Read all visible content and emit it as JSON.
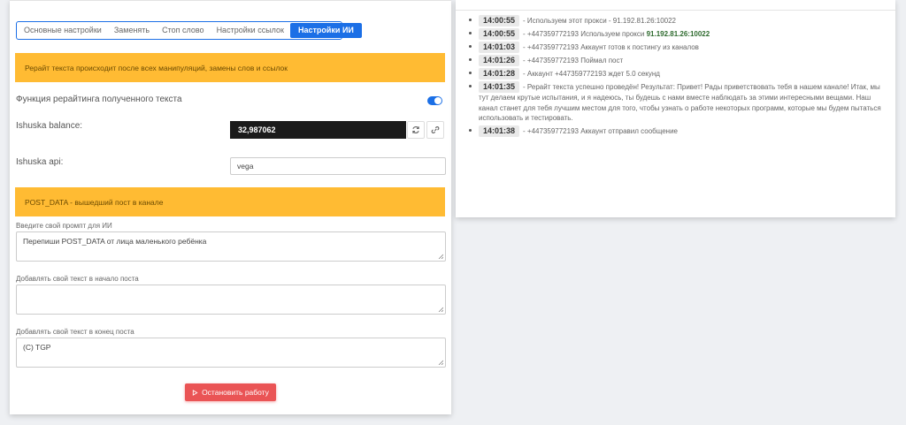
{
  "tabs": [
    {
      "label": "Основные настройки"
    },
    {
      "label": "Заменять"
    },
    {
      "label": "Стоп слово"
    },
    {
      "label": "Настройки ссылок"
    },
    {
      "label": "Настройки ИИ",
      "active": true
    }
  ],
  "alert_rewrite": "Рерайт текста происходит после всех манипуляций, замены слов и ссылок",
  "rewrite_function_label": "Функция рерайтинга полученного текста",
  "rewrite_enabled": true,
  "balance_label": "Ishuska balance:",
  "balance_value": "32,987062",
  "api_label": "Ishuska api:",
  "api_value": "vega",
  "alert_post_data": "POST_DATA - вышедший пост в канале",
  "prompt_label": "Введите свой промпт для ИИ",
  "prompt_value": "Перепиши POST_DATA от лица маленького ребёнка",
  "prefix_label": "Добавлять свой текст в начало поста",
  "prefix_value": "",
  "suffix_label": "Добавлять свой текст в конец поста",
  "suffix_value": "(C) TGP",
  "stop_button": "Остановить работу",
  "colors": {
    "accent": "#1b6fe6",
    "alert": "#ffbb33",
    "danger": "#ea5455",
    "success": "#28c76f"
  },
  "log": [
    {
      "time": "14:00:55",
      "text": "- Используем этот прокси - 91.192.81.26:10022"
    },
    {
      "time": "14:00:55",
      "text": "- +447359772193 Используем прокси ",
      "highlight": "91.192.81.26:10022"
    },
    {
      "time": "14:01:03",
      "text": "- +447359772193 Аккаунт готов к постингу из каналов"
    },
    {
      "time": "14:01:26",
      "text": "- +447359772193 Поймал пост"
    },
    {
      "time": "14:01:28",
      "text": "- Аккаунт +447359772193 ждет 5.0 секунд"
    },
    {
      "time": "14:01:35",
      "text": "- Рерайт текста успешно проведён! Результат: Привет! Рады приветствовать тебя в нашем канале! Итак, мы тут делаем крутые испытания, и я надеюсь, ты будешь с нами вместе наблюдать за этими интересными вещами. Наш канал станет для тебя лучшим местом для того, чтобы узнать о работе некоторых программ, которые мы будем пытаться использовать и тестировать."
    },
    {
      "time": "14:01:38",
      "text": "- +447359772193 Аккаунт отправил сообщение"
    }
  ]
}
